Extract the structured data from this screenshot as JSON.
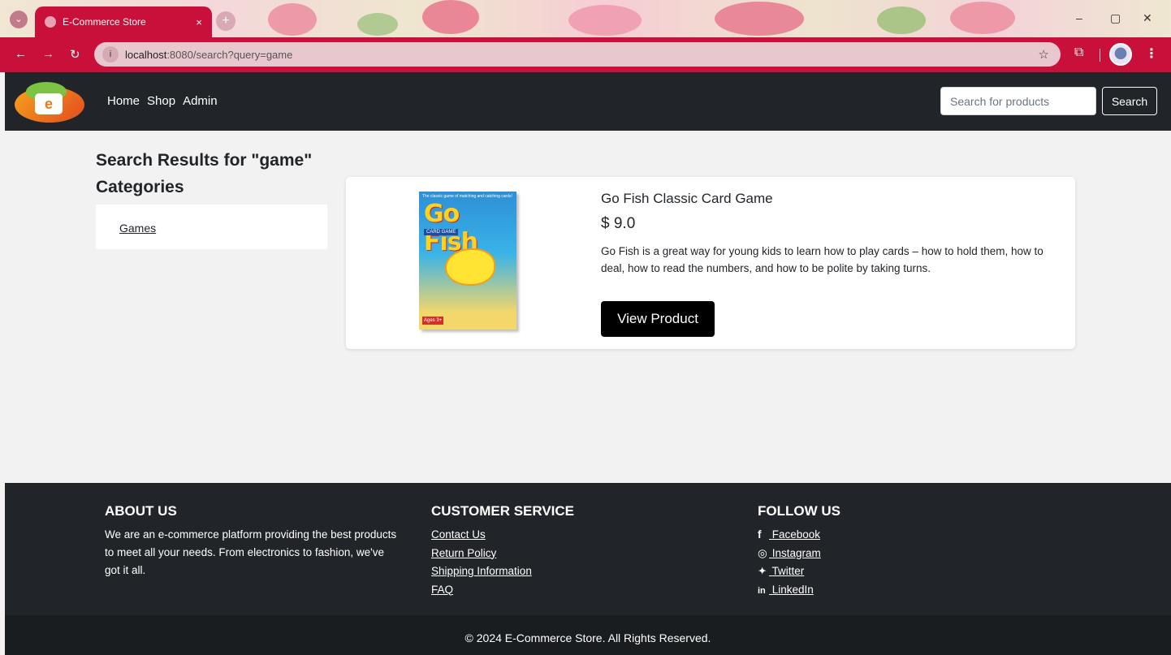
{
  "browser": {
    "tab_title": "E-Commerce Store",
    "tab_close": "×",
    "new_tab": "+",
    "url_host": "localhost",
    "url_rest": ":8080/search?query=game",
    "window_minimize": "–",
    "window_restore": "▢",
    "window_close": "✕",
    "back": "←",
    "forward": "→",
    "reload": "↻",
    "bookmark_star": "☆",
    "extensions": "⧉",
    "menu": "⋮"
  },
  "navbar": {
    "links": [
      "Home",
      "Shop",
      "Admin"
    ],
    "search_placeholder": "Search for products",
    "search_button": "Search"
  },
  "main": {
    "heading": "Search Results for \"game\"",
    "categories_heading": "Categories",
    "categories": [
      "Games"
    ]
  },
  "product": {
    "name": "Go Fish Classic Card Game",
    "price": "$ 9.0",
    "description": "Go Fish is a great way for young kids to learn how to play cards – how to hold them, how to deal, how to read the numbers, and how to be polite by taking turns.",
    "button": "View Product",
    "image": {
      "tagline": "The classic game of matching and catching cards!",
      "brand": "Go Fish",
      "subtitle": "CARD GAME",
      "age": "Ages 3+"
    }
  },
  "footer": {
    "about": {
      "title": "ABOUT US",
      "text": "We are an e-commerce platform providing the best products to meet all your needs. From electronics to fashion, we've got it all."
    },
    "customer_service": {
      "title": "CUSTOMER SERVICE",
      "links": [
        "Contact Us",
        "Return Policy",
        "Shipping Information",
        "FAQ"
      ]
    },
    "follow": {
      "title": "FOLLOW US",
      "links": [
        {
          "icon": "facebook-icon",
          "glyph": "f",
          "label": " Facebook"
        },
        {
          "icon": "instagram-icon",
          "glyph": "◎",
          "label": " Instagram"
        },
        {
          "icon": "twitter-icon",
          "glyph": "✦",
          "label": " Twitter"
        },
        {
          "icon": "linkedin-icon",
          "glyph": "in",
          "label": " LinkedIn"
        }
      ]
    },
    "copyright": "© 2024 E-Commerce Store. All Rights Reserved."
  },
  "colors": {
    "browser_accent": "#c8103a",
    "navbar_bg": "#212529",
    "page_bg": "#f2f2f2",
    "button_bg": "#000000"
  }
}
